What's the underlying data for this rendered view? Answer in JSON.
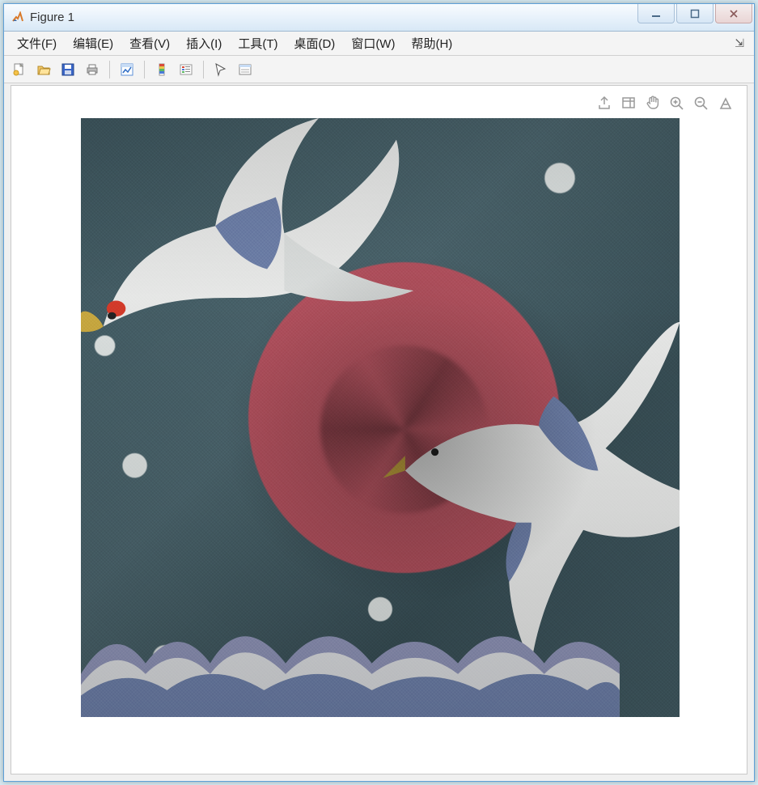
{
  "window": {
    "title": "Figure 1"
  },
  "menubar": {
    "items": [
      {
        "label": "文件(F)"
      },
      {
        "label": "编辑(E)"
      },
      {
        "label": "查看(V)"
      },
      {
        "label": "插入(I)"
      },
      {
        "label": "工具(T)"
      },
      {
        "label": "桌面(D)"
      },
      {
        "label": "窗口(W)"
      },
      {
        "label": "帮助(H)"
      }
    ]
  },
  "toolbar": {
    "buttons": [
      {
        "name": "new-figure-icon"
      },
      {
        "name": "open-file-icon"
      },
      {
        "name": "save-icon"
      },
      {
        "name": "print-icon"
      },
      {
        "name": "sep"
      },
      {
        "name": "link-plot-icon"
      },
      {
        "name": "sep"
      },
      {
        "name": "colorbar-icon"
      },
      {
        "name": "legend-icon"
      },
      {
        "name": "sep"
      },
      {
        "name": "edit-plot-icon"
      },
      {
        "name": "property-inspector-icon"
      }
    ]
  },
  "axes_toolbar": {
    "buttons": [
      {
        "name": "export-icon"
      },
      {
        "name": "brush-icon"
      },
      {
        "name": "pan-icon"
      },
      {
        "name": "zoom-in-icon"
      },
      {
        "name": "zoom-out-icon"
      },
      {
        "name": "restore-view-icon"
      }
    ]
  },
  "image_content": {
    "description": "twisted knitted fabric texture depicting two white cranes flying over a red sun with stylized ocean waves and falling snow on a teal background",
    "palette": {
      "background_teal": "#45606a",
      "sun_red": "#bd5864",
      "crane_white": "#e6e7e6",
      "crane_accent_blue": "#6d7fa8",
      "crane_beak_yellow": "#c7a740",
      "wave_foam": "#d8dadd",
      "wave_shadow": "#8d92b5"
    }
  }
}
